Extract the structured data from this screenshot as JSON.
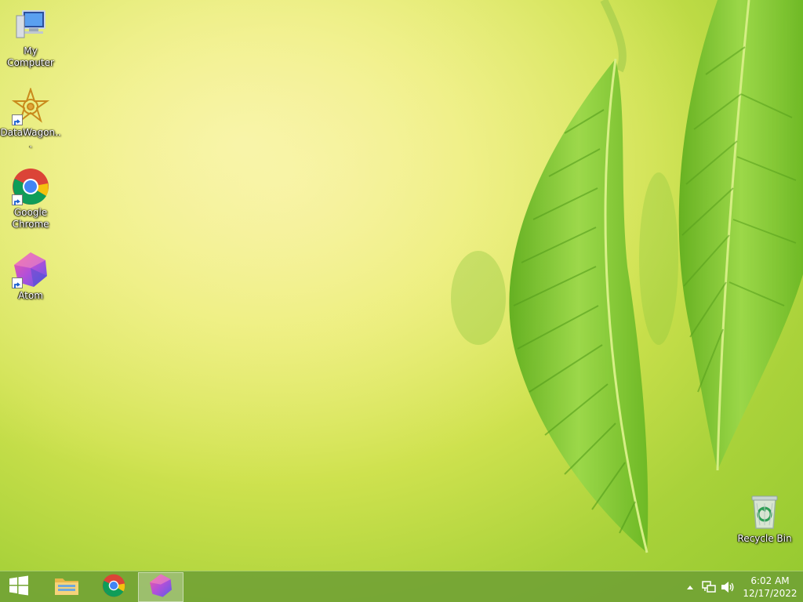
{
  "desktop": {
    "icons": [
      {
        "label": "My Computer",
        "icon": "computer-icon"
      },
      {
        "label": "DataWagon...",
        "icon": "datawagon-icon"
      },
      {
        "label": "Google Chrome",
        "icon": "chrome-icon"
      },
      {
        "label": "Atom",
        "icon": "atom-icon"
      },
      {
        "label": "Recycle Bin",
        "icon": "recycle-bin-icon"
      }
    ]
  },
  "taskbar": {
    "start_icon": "windows-logo-icon",
    "pinned": [
      {
        "icon": "file-explorer-icon",
        "active": false
      },
      {
        "icon": "chrome-icon",
        "active": false
      },
      {
        "icon": "atom-icon",
        "active": true
      }
    ],
    "tray": {
      "icons": [
        "show-hidden-icons-chevron",
        "network-icon",
        "volume-icon"
      ],
      "time": "6:02 AM",
      "date": "12/17/2022"
    }
  },
  "colors": {
    "wallpaper_bright": "#f3ef8a",
    "wallpaper_green": "#94c92f",
    "leaf_green": "#7fc62a",
    "taskbar": "#70a034"
  }
}
